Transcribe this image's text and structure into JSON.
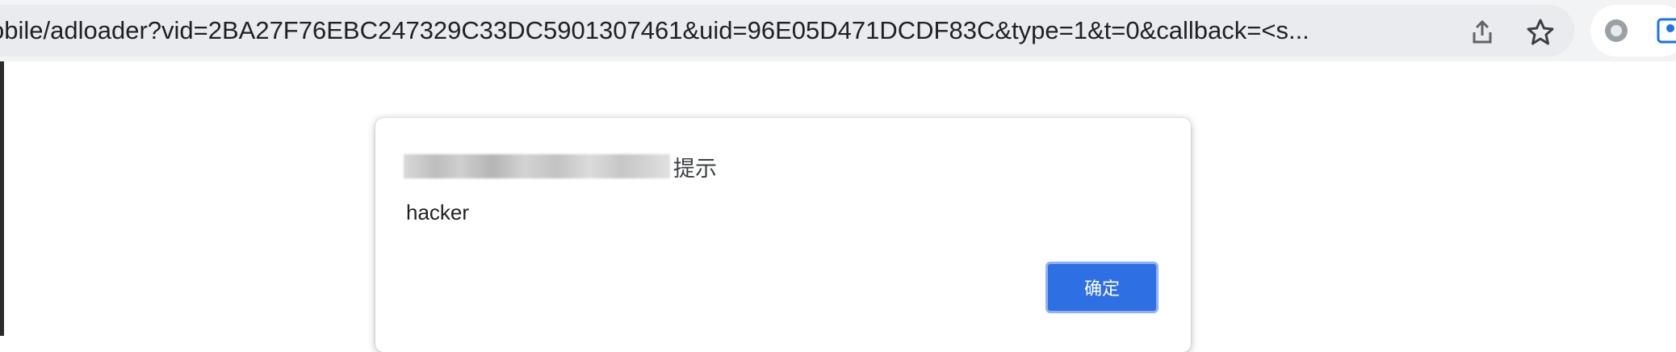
{
  "browser": {
    "address_bar": {
      "url": "obile/adloader?vid=2BA27F76EBC247329C33DC5901307461&uid=96E05D471DCDF83C&type=1&t=0&callback=<s..."
    },
    "icons": [
      "share-icon",
      "bookmark-star-icon",
      "extension-icon",
      "profile-icon"
    ]
  },
  "dialog": {
    "title_suffix": "提示",
    "message": "hacker",
    "ok_label": "确定"
  },
  "colors": {
    "accent": "#2f6fe4",
    "toolbar_bg": "#f1f3f4",
    "text": "#202124"
  }
}
